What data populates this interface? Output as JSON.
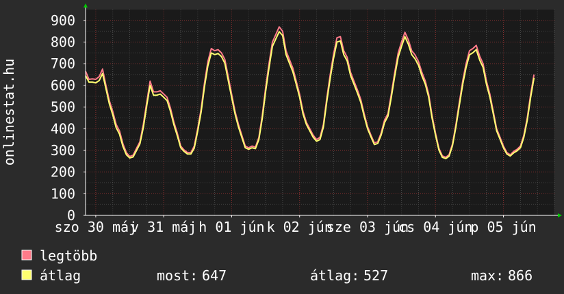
{
  "chart_data": {
    "type": "line",
    "ylabel": "onlinestat.hu",
    "ylim": [
      0,
      950
    ],
    "y_ticks": [
      0,
      100,
      200,
      300,
      400,
      500,
      600,
      700,
      800,
      900
    ],
    "x_ticks": [
      {
        "label": "szo 30 máj",
        "day": 0
      },
      {
        "label": "v 31 máj",
        "day": 1
      },
      {
        "label": "h 01 jún",
        "day": 2
      },
      {
        "label": "k 02 jún",
        "day": 3
      },
      {
        "label": "sze 03 jún",
        "day": 4
      },
      {
        "label": "cs 04 jún",
        "day": 5
      },
      {
        "label": "p 05 jún",
        "day": 6
      }
    ],
    "x_range_days": [
      -0.15,
      6.75
    ],
    "grid": true,
    "series": [
      {
        "name": "legtöbb",
        "color": "#ff7b8a",
        "points": [
          [
            -0.15,
            665
          ],
          [
            -0.1,
            628
          ],
          [
            -0.05,
            630
          ],
          [
            0.0,
            628
          ],
          [
            0.05,
            640
          ],
          [
            0.1,
            675
          ],
          [
            0.15,
            600
          ],
          [
            0.2,
            530
          ],
          [
            0.25,
            480
          ],
          [
            0.3,
            420
          ],
          [
            0.35,
            390
          ],
          [
            0.4,
            330
          ],
          [
            0.45,
            290
          ],
          [
            0.5,
            272
          ],
          [
            0.55,
            278
          ],
          [
            0.6,
            310
          ],
          [
            0.65,
            340
          ],
          [
            0.7,
            420
          ],
          [
            0.75,
            520
          ],
          [
            0.8,
            620
          ],
          [
            0.85,
            570
          ],
          [
            0.9,
            570
          ],
          [
            0.95,
            575
          ],
          [
            1.0,
            560
          ],
          [
            1.05,
            545
          ],
          [
            1.1,
            495
          ],
          [
            1.15,
            430
          ],
          [
            1.2,
            380
          ],
          [
            1.25,
            320
          ],
          [
            1.3,
            302
          ],
          [
            1.35,
            290
          ],
          [
            1.4,
            290
          ],
          [
            1.45,
            320
          ],
          [
            1.5,
            400
          ],
          [
            1.55,
            490
          ],
          [
            1.6,
            610
          ],
          [
            1.65,
            710
          ],
          [
            1.7,
            770
          ],
          [
            1.75,
            760
          ],
          [
            1.8,
            765
          ],
          [
            1.85,
            750
          ],
          [
            1.9,
            720
          ],
          [
            1.95,
            640
          ],
          [
            2.0,
            560
          ],
          [
            2.05,
            480
          ],
          [
            2.1,
            420
          ],
          [
            2.15,
            370
          ],
          [
            2.2,
            320
          ],
          [
            2.25,
            312
          ],
          [
            2.3,
            320
          ],
          [
            2.35,
            315
          ],
          [
            2.4,
            360
          ],
          [
            2.45,
            460
          ],
          [
            2.5,
            590
          ],
          [
            2.55,
            700
          ],
          [
            2.6,
            800
          ],
          [
            2.65,
            835
          ],
          [
            2.7,
            870
          ],
          [
            2.75,
            850
          ],
          [
            2.8,
            760
          ],
          [
            2.85,
            720
          ],
          [
            2.9,
            680
          ],
          [
            2.95,
            620
          ],
          [
            3.0,
            560
          ],
          [
            3.05,
            480
          ],
          [
            3.1,
            430
          ],
          [
            3.15,
            400
          ],
          [
            3.2,
            370
          ],
          [
            3.25,
            350
          ],
          [
            3.3,
            360
          ],
          [
            3.35,
            420
          ],
          [
            3.4,
            540
          ],
          [
            3.45,
            650
          ],
          [
            3.5,
            745
          ],
          [
            3.55,
            820
          ],
          [
            3.6,
            825
          ],
          [
            3.65,
            760
          ],
          [
            3.7,
            730
          ],
          [
            3.75,
            660
          ],
          [
            3.8,
            620
          ],
          [
            3.85,
            580
          ],
          [
            3.9,
            535
          ],
          [
            3.95,
            470
          ],
          [
            4.0,
            410
          ],
          [
            4.05,
            370
          ],
          [
            4.1,
            335
          ],
          [
            4.15,
            340
          ],
          [
            4.2,
            380
          ],
          [
            4.25,
            440
          ],
          [
            4.3,
            470
          ],
          [
            4.35,
            560
          ],
          [
            4.4,
            660
          ],
          [
            4.45,
            750
          ],
          [
            4.5,
            800
          ],
          [
            4.55,
            845
          ],
          [
            4.6,
            810
          ],
          [
            4.65,
            760
          ],
          [
            4.7,
            740
          ],
          [
            4.75,
            710
          ],
          [
            4.8,
            660
          ],
          [
            4.85,
            620
          ],
          [
            4.9,
            560
          ],
          [
            4.95,
            460
          ],
          [
            5.0,
            380
          ],
          [
            5.05,
            310
          ],
          [
            5.1,
            275
          ],
          [
            5.15,
            268
          ],
          [
            5.2,
            280
          ],
          [
            5.25,
            330
          ],
          [
            5.3,
            420
          ],
          [
            5.35,
            520
          ],
          [
            5.4,
            620
          ],
          [
            5.45,
            700
          ],
          [
            5.5,
            760
          ],
          [
            5.55,
            770
          ],
          [
            5.6,
            785
          ],
          [
            5.65,
            735
          ],
          [
            5.7,
            700
          ],
          [
            5.75,
            620
          ],
          [
            5.8,
            560
          ],
          [
            5.85,
            480
          ],
          [
            5.9,
            400
          ],
          [
            5.95,
            360
          ],
          [
            6.0,
            320
          ],
          [
            6.05,
            290
          ],
          [
            6.1,
            280
          ],
          [
            6.15,
            295
          ],
          [
            6.2,
            305
          ],
          [
            6.25,
            320
          ],
          [
            6.3,
            370
          ],
          [
            6.35,
            450
          ],
          [
            6.4,
            560
          ],
          [
            6.45,
            650
          ]
        ]
      },
      {
        "name": "átlag",
        "color": "#ffff70",
        "points": [
          [
            -0.15,
            645
          ],
          [
            -0.1,
            615
          ],
          [
            -0.05,
            615
          ],
          [
            0.0,
            612
          ],
          [
            0.05,
            622
          ],
          [
            0.1,
            655
          ],
          [
            0.15,
            585
          ],
          [
            0.2,
            515
          ],
          [
            0.25,
            465
          ],
          [
            0.3,
            405
          ],
          [
            0.35,
            375
          ],
          [
            0.4,
            318
          ],
          [
            0.45,
            280
          ],
          [
            0.5,
            265
          ],
          [
            0.55,
            270
          ],
          [
            0.6,
            300
          ],
          [
            0.65,
            330
          ],
          [
            0.7,
            405
          ],
          [
            0.75,
            505
          ],
          [
            0.8,
            600
          ],
          [
            0.85,
            555
          ],
          [
            0.9,
            555
          ],
          [
            0.95,
            560
          ],
          [
            1.0,
            545
          ],
          [
            1.05,
            530
          ],
          [
            1.1,
            480
          ],
          [
            1.15,
            418
          ],
          [
            1.2,
            368
          ],
          [
            1.25,
            312
          ],
          [
            1.3,
            295
          ],
          [
            1.35,
            283
          ],
          [
            1.4,
            283
          ],
          [
            1.45,
            310
          ],
          [
            1.5,
            388
          ],
          [
            1.55,
            476
          ],
          [
            1.6,
            592
          ],
          [
            1.65,
            690
          ],
          [
            1.7,
            750
          ],
          [
            1.75,
            742
          ],
          [
            1.8,
            747
          ],
          [
            1.85,
            733
          ],
          [
            1.9,
            702
          ],
          [
            1.95,
            622
          ],
          [
            2.0,
            545
          ],
          [
            2.05,
            468
          ],
          [
            2.1,
            408
          ],
          [
            2.15,
            360
          ],
          [
            2.2,
            312
          ],
          [
            2.25,
            305
          ],
          [
            2.3,
            312
          ],
          [
            2.35,
            308
          ],
          [
            2.4,
            350
          ],
          [
            2.45,
            446
          ],
          [
            2.5,
            572
          ],
          [
            2.55,
            680
          ],
          [
            2.6,
            780
          ],
          [
            2.65,
            815
          ],
          [
            2.7,
            848
          ],
          [
            2.75,
            830
          ],
          [
            2.8,
            742
          ],
          [
            2.85,
            703
          ],
          [
            2.9,
            663
          ],
          [
            2.95,
            605
          ],
          [
            3.0,
            546
          ],
          [
            3.05,
            468
          ],
          [
            3.1,
            420
          ],
          [
            3.15,
            390
          ],
          [
            3.2,
            360
          ],
          [
            3.25,
            342
          ],
          [
            3.3,
            350
          ],
          [
            3.35,
            408
          ],
          [
            3.4,
            525
          ],
          [
            3.45,
            632
          ],
          [
            3.5,
            726
          ],
          [
            3.55,
            800
          ],
          [
            3.6,
            805
          ],
          [
            3.65,
            742
          ],
          [
            3.7,
            713
          ],
          [
            3.75,
            645
          ],
          [
            3.8,
            606
          ],
          [
            3.85,
            566
          ],
          [
            3.9,
            522
          ],
          [
            3.95,
            458
          ],
          [
            4.0,
            400
          ],
          [
            4.05,
            362
          ],
          [
            4.1,
            327
          ],
          [
            4.15,
            332
          ],
          [
            4.2,
            370
          ],
          [
            4.25,
            428
          ],
          [
            4.3,
            458
          ],
          [
            4.35,
            545
          ],
          [
            4.4,
            643
          ],
          [
            4.45,
            730
          ],
          [
            4.5,
            780
          ],
          [
            4.55,
            825
          ],
          [
            4.6,
            790
          ],
          [
            4.65,
            742
          ],
          [
            4.7,
            722
          ],
          [
            4.75,
            693
          ],
          [
            4.8,
            644
          ],
          [
            4.85,
            605
          ],
          [
            4.9,
            546
          ],
          [
            4.95,
            448
          ],
          [
            5.0,
            370
          ],
          [
            5.05,
            302
          ],
          [
            5.1,
            268
          ],
          [
            5.15,
            262
          ],
          [
            5.2,
            273
          ],
          [
            5.25,
            322
          ],
          [
            5.3,
            408
          ],
          [
            5.35,
            506
          ],
          [
            5.4,
            604
          ],
          [
            5.45,
            682
          ],
          [
            5.5,
            741
          ],
          [
            5.55,
            751
          ],
          [
            5.6,
            765
          ],
          [
            5.65,
            717
          ],
          [
            5.7,
            683
          ],
          [
            5.75,
            605
          ],
          [
            5.8,
            546
          ],
          [
            5.85,
            468
          ],
          [
            5.9,
            390
          ],
          [
            5.95,
            351
          ],
          [
            6.0,
            312
          ],
          [
            6.05,
            283
          ],
          [
            6.1,
            274
          ],
          [
            6.15,
            288
          ],
          [
            6.2,
            298
          ],
          [
            6.25,
            312
          ],
          [
            6.3,
            360
          ],
          [
            6.35,
            438
          ],
          [
            6.4,
            545
          ],
          [
            6.45,
            635
          ]
        ]
      }
    ],
    "legend": [
      {
        "name": "legtöbb",
        "color": "#ff7b8a"
      },
      {
        "name": "átlag",
        "color": "#ffff70"
      }
    ],
    "stats": [
      {
        "label": "most:",
        "value": "647"
      },
      {
        "label": "átlag:",
        "value": "527"
      },
      {
        "label": "max:",
        "value": "866"
      }
    ]
  }
}
